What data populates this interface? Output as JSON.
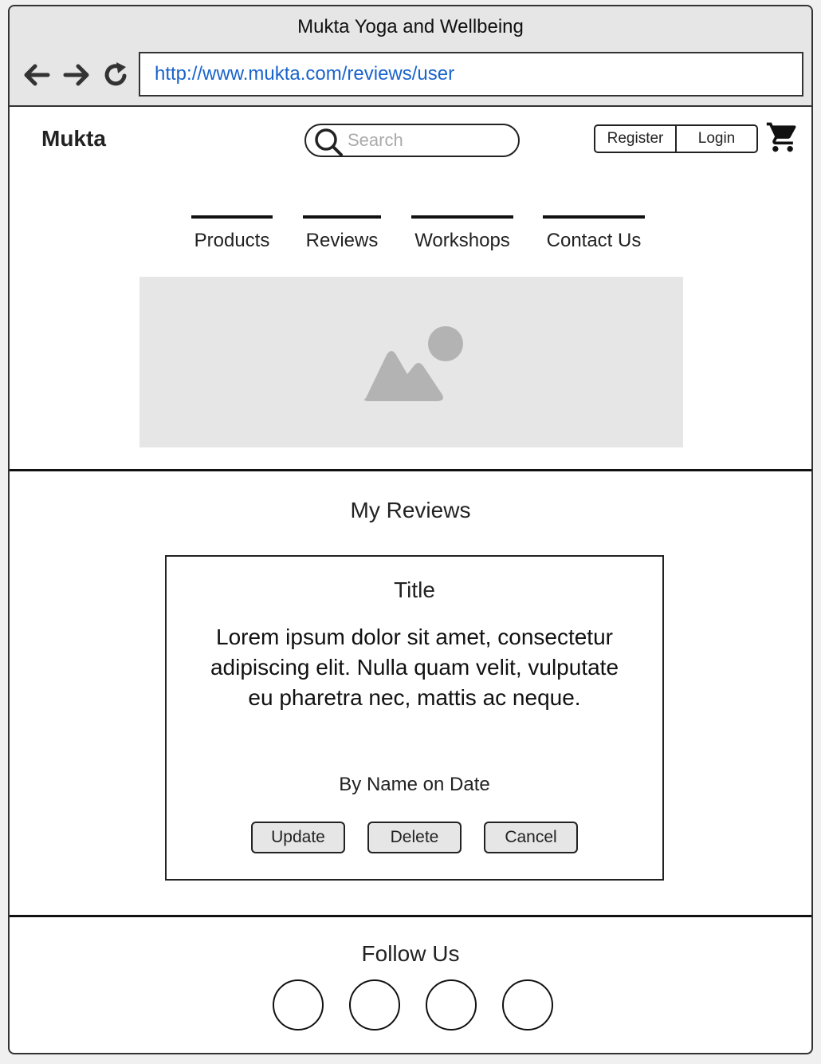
{
  "browser": {
    "title": "Mukta Yoga and Wellbeing",
    "url": "http://www.mukta.com/reviews/user",
    "nav_icons": [
      "back-arrow-icon",
      "forward-arrow-icon",
      "reload-icon"
    ]
  },
  "header": {
    "logo": "Mukta",
    "search_placeholder": "Search",
    "register_label": "Register",
    "login_label": "Login",
    "cart_icon": "cart-icon"
  },
  "nav": {
    "items": [
      {
        "label": "Products"
      },
      {
        "label": "Reviews"
      },
      {
        "label": "Workshops"
      },
      {
        "label": "Contact Us"
      }
    ]
  },
  "hero": {
    "icon": "image-placeholder-icon",
    "background": "#e6e6e6",
    "icon_color": "#b3b3b3"
  },
  "reviews": {
    "heading": "My Reviews",
    "card": {
      "title": "Title",
      "body": "Lorem ipsum dolor sit amet, consectetur adipiscing elit. Nulla quam velit, vulputate eu pharetra nec, mattis ac neque.",
      "byline": "By Name on Date",
      "actions": {
        "update": "Update",
        "delete": "Delete",
        "cancel": "Cancel"
      }
    }
  },
  "footer": {
    "heading": "Follow Us",
    "social_icons": [
      "social-icon-1",
      "social-icon-2",
      "social-icon-3",
      "social-icon-4"
    ]
  },
  "colors": {
    "link": "#1a64cc",
    "chrome": "#e6e6e6",
    "border": "#222222"
  }
}
